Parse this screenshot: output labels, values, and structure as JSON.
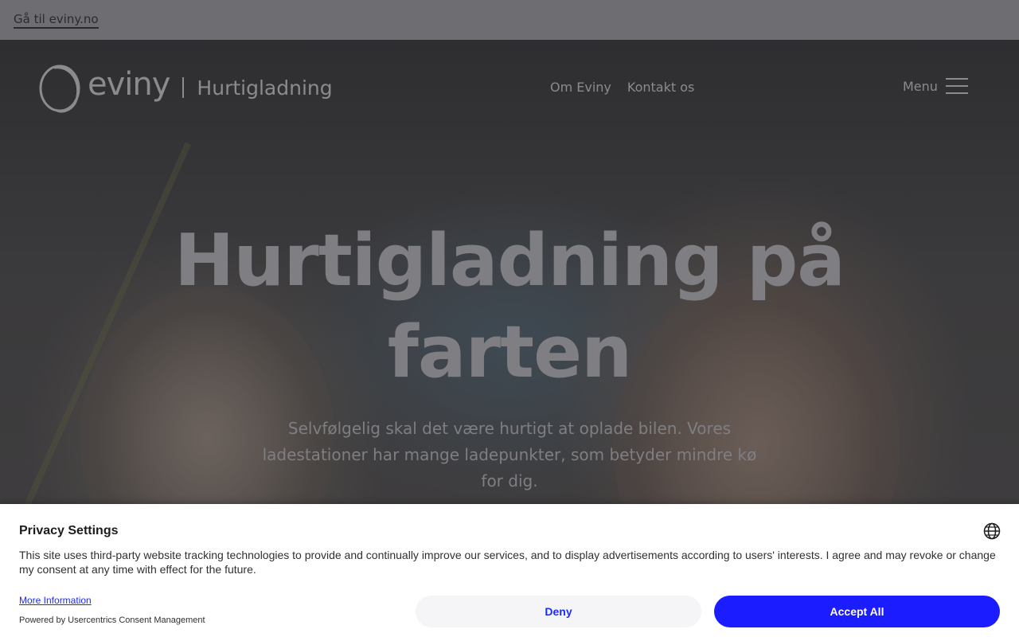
{
  "topbar": {
    "link_label": "Gå til eviny.no"
  },
  "header": {
    "brand": "eviny",
    "section": "Hurtigladning",
    "nav": [
      {
        "label": "Om Eviny"
      },
      {
        "label": "Kontakt os"
      }
    ],
    "menu_label": "Menu"
  },
  "hero": {
    "headline": "Hurtigladning på farten",
    "lead": "Selvfølgelig skal det være hurtigt at oplade bilen. Vores ladestationer har mange ladepunkter, som betyder mindre kø for dig."
  },
  "consent": {
    "title": "Privacy Settings",
    "body": "This site uses third-party website tracking technologies to provide and continually improve our services, and to display advertisements according to users' interests. I agree and may revoke or change my consent at any time with effect for the future.",
    "more_info": "More Information",
    "powered_by": "Powered by Usercentrics Consent Management",
    "deny_label": "Deny",
    "accept_label": "Accept All",
    "accent_color": "#1b1cff"
  },
  "icons": [
    "globe-icon",
    "hamburger-menu-icon",
    "eviny-logo-ring-icon"
  ]
}
